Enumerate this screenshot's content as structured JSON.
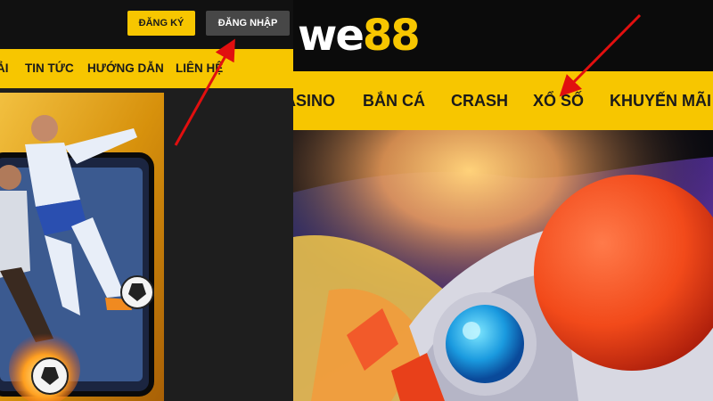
{
  "right": {
    "logo_prefix": "we",
    "logo_suffix": "88",
    "nav": [
      "ASINO",
      "BẮN CÁ",
      "CRASH",
      "XỔ SỐ",
      "KHUYẾN MÃI"
    ]
  },
  "left": {
    "register_label": "ĐĂNG KÝ",
    "login_label": "ĐĂNG NHẬP",
    "nav": [
      "ẢI",
      "TIN TỨC",
      "HƯỚNG DẪN",
      "LIÊN HỆ"
    ]
  },
  "colors": {
    "brand_yellow": "#f7c600",
    "annotation_red": "#e10f0f",
    "login_gray": "#474747"
  },
  "icons": {
    "logo": "we88-logo",
    "promo": "football-player-promo-image",
    "banner": "crash-rocket-banner-image",
    "annotation": "red-arrow-annotation"
  }
}
